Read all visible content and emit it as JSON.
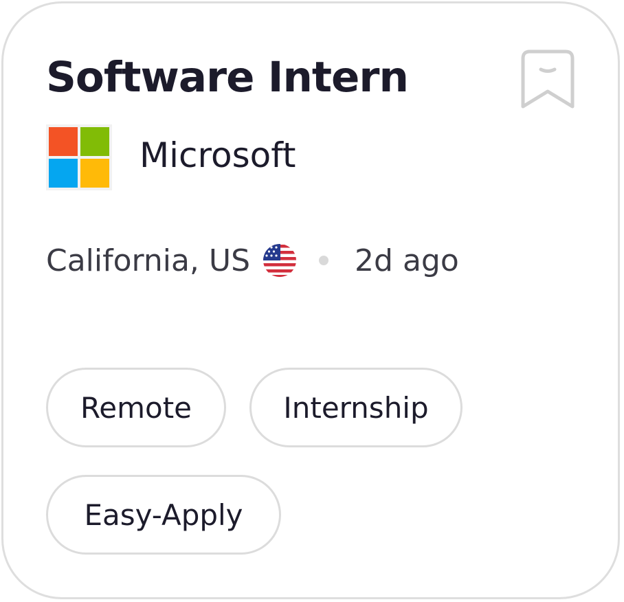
{
  "job": {
    "title": "Software Intern",
    "company": "Microsoft",
    "location": "California, US",
    "posted": "2d ago",
    "tags": [
      "Remote",
      "Internship",
      "Easy-Apply"
    ]
  },
  "icons": {
    "bookmark": "bookmark-icon",
    "company_logo": "microsoft-logo",
    "flag": "us-flag-icon"
  },
  "colors": {
    "logo_red": "#f35325",
    "logo_green": "#81bc06",
    "logo_blue": "#05a6f0",
    "logo_yellow": "#ffba08",
    "text_primary": "#1c1b2b",
    "border": "#dedede"
  }
}
